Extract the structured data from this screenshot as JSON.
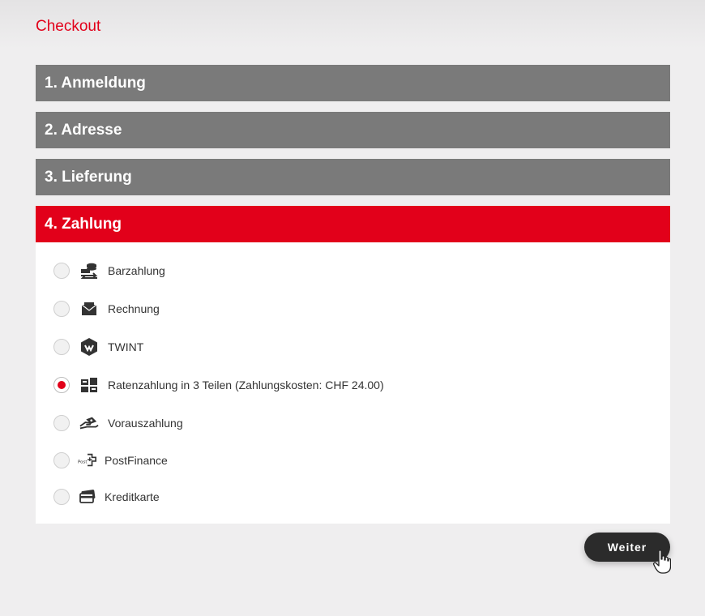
{
  "page": {
    "title": "Checkout"
  },
  "steps": [
    {
      "label": "1. Anmeldung",
      "state": "collapsed"
    },
    {
      "label": "2. Adresse",
      "state": "collapsed"
    },
    {
      "label": "3. Lieferung",
      "state": "collapsed"
    },
    {
      "label": "4. Zahlung",
      "state": "active"
    }
  ],
  "payment": {
    "options": [
      {
        "label": "Barzahlung",
        "icon": "cash-coins-icon",
        "selected": false
      },
      {
        "label": "Rechnung",
        "icon": "envelope-icon",
        "selected": false
      },
      {
        "label": "TWINT",
        "icon": "twint-icon",
        "selected": false
      },
      {
        "label": "Ratenzahlung in 3 Teilen (Zahlungskosten: CHF 24.00)",
        "icon": "installment-icon",
        "selected": true
      },
      {
        "label": "Vorauszahlung",
        "icon": "prepayment-hand-icon",
        "selected": false
      },
      {
        "label": "PostFinance",
        "icon": "postfinance-icon",
        "selected": false
      },
      {
        "label": "Kreditkarte",
        "icon": "credit-card-icon",
        "selected": false
      }
    ]
  },
  "actions": {
    "next_label": "Weiter"
  },
  "colors": {
    "accent": "#e2001a",
    "step_inactive": "#7a7a7a",
    "button_dark": "#2b2b2b"
  }
}
